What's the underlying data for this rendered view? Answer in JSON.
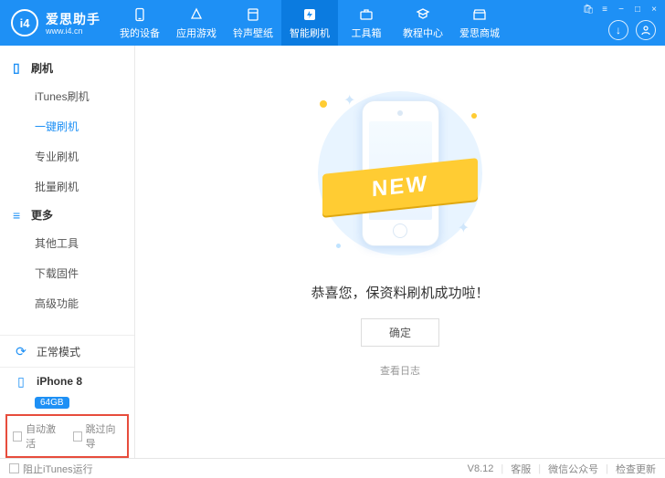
{
  "header": {
    "logo_text": "爱思助手",
    "logo_url": "www.i4.cn",
    "logo_badge": "i4",
    "nav": [
      {
        "label": "我的设备",
        "icon": "device"
      },
      {
        "label": "应用游戏",
        "icon": "apps"
      },
      {
        "label": "铃声壁纸",
        "icon": "music"
      },
      {
        "label": "智能刷机",
        "icon": "flash",
        "active": true
      },
      {
        "label": "工具箱",
        "icon": "toolbox"
      },
      {
        "label": "教程中心",
        "icon": "tutorial"
      },
      {
        "label": "爱思商城",
        "icon": "store"
      }
    ]
  },
  "sidebar": {
    "groups": [
      {
        "title": "刷机",
        "icon": "phone",
        "items": [
          {
            "label": "iTunes刷机"
          },
          {
            "label": "一键刷机",
            "active": true
          },
          {
            "label": "专业刷机"
          },
          {
            "label": "批量刷机"
          }
        ]
      },
      {
        "title": "更多",
        "icon": "more",
        "items": [
          {
            "label": "其他工具"
          },
          {
            "label": "下载固件"
          },
          {
            "label": "高级功能"
          }
        ]
      }
    ],
    "mode": "正常模式",
    "device": {
      "name": "iPhone 8",
      "storage": "64GB"
    },
    "options": {
      "auto_activate": "自动激活",
      "skip_guide": "跳过向导"
    }
  },
  "main": {
    "ribbon_text": "NEW",
    "success_text": "恭喜您，保资料刷机成功啦！",
    "ok_button": "确定",
    "view_log": "查看日志"
  },
  "footer": {
    "block_itunes": "阻止iTunes运行",
    "version": "V8.12",
    "support": "客服",
    "wechat": "微信公众号",
    "check_update": "检查更新"
  }
}
